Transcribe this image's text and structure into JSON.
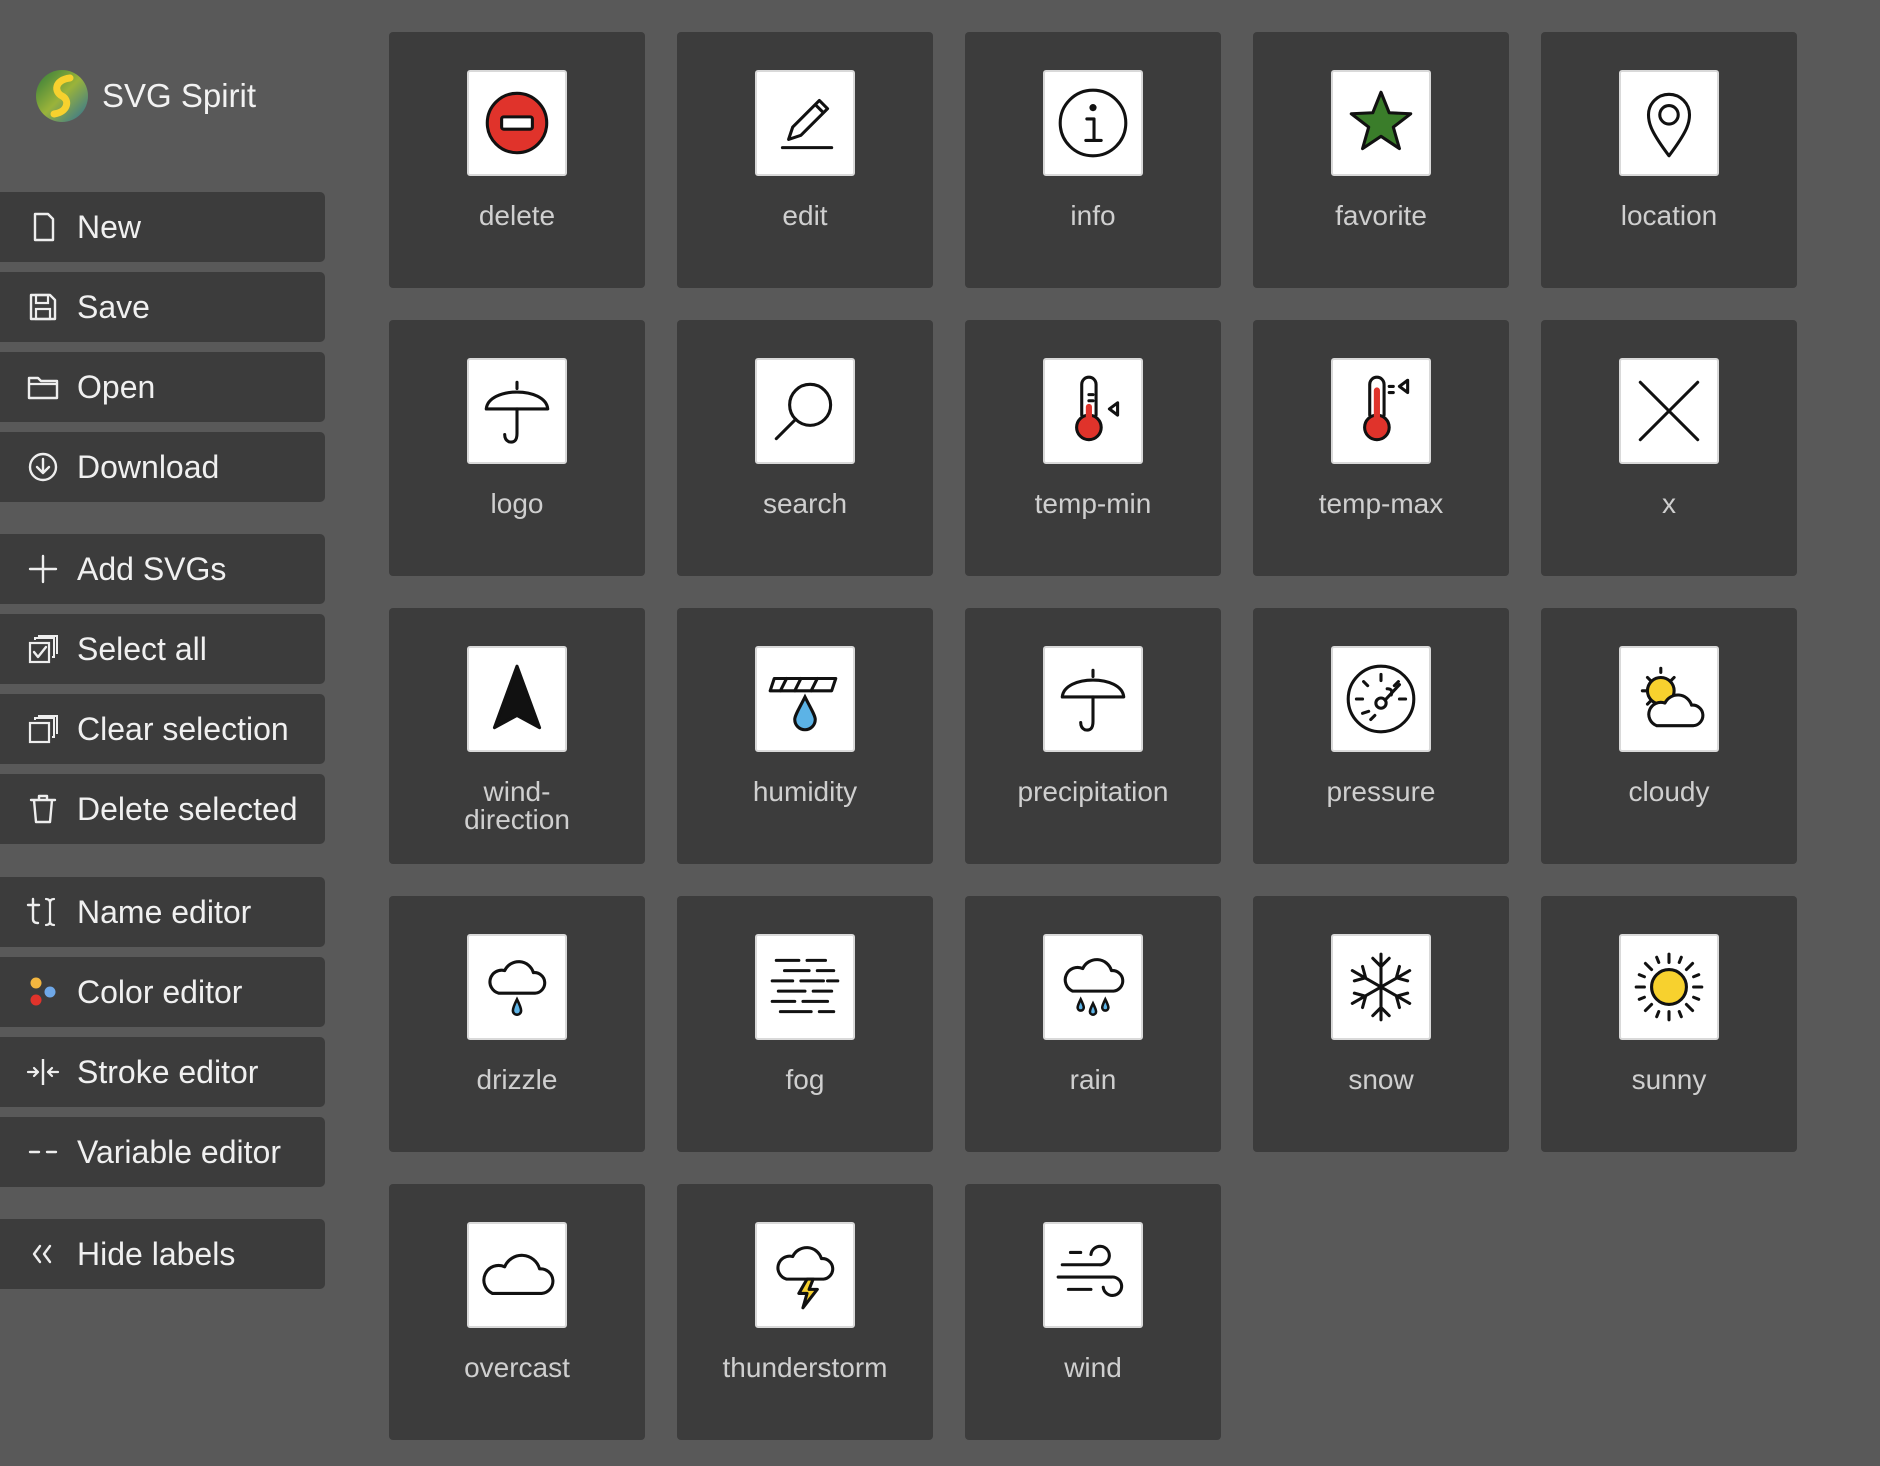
{
  "brand": {
    "name": "SVG Spirit",
    "logo_icon": "spirit-logo-icon"
  },
  "sidebar": {
    "buttons": [
      {
        "id": "new",
        "label": "New",
        "icon": "new-file-icon"
      },
      {
        "id": "save",
        "label": "Save",
        "icon": "save-icon"
      },
      {
        "id": "open",
        "label": "Open",
        "icon": "folder-icon"
      },
      {
        "id": "download",
        "label": "Download",
        "icon": "download-icon"
      },
      {
        "id": "add-svgs",
        "label": "Add SVGs",
        "icon": "plus-icon"
      },
      {
        "id": "select-all",
        "label": "Select all",
        "icon": "select-all-icon"
      },
      {
        "id": "clear-selection",
        "label": "Clear selection",
        "icon": "clear-selection-icon"
      },
      {
        "id": "delete-selected",
        "label": "Delete selected",
        "icon": "trash-icon"
      },
      {
        "id": "name-editor",
        "label": "Name editor",
        "icon": "text-cursor-icon"
      },
      {
        "id": "color-editor",
        "label": "Color editor",
        "icon": "color-dots-icon"
      },
      {
        "id": "stroke-editor",
        "label": "Stroke editor",
        "icon": "stroke-width-icon"
      },
      {
        "id": "variable-editor",
        "label": "Variable editor",
        "icon": "dashes-icon"
      },
      {
        "id": "hide-labels",
        "label": "Hide labels",
        "icon": "chevrons-left-icon"
      }
    ]
  },
  "grid": {
    "items": [
      {
        "label": "delete",
        "icon": "delete-icon"
      },
      {
        "label": "edit",
        "icon": "edit-icon"
      },
      {
        "label": "info",
        "icon": "info-icon"
      },
      {
        "label": "favorite",
        "icon": "favorite-icon"
      },
      {
        "label": "location",
        "icon": "location-icon"
      },
      {
        "label": "logo",
        "icon": "umbrella-icon"
      },
      {
        "label": "search",
        "icon": "search-icon"
      },
      {
        "label": "temp-min",
        "icon": "temp-min-icon"
      },
      {
        "label": "temp-max",
        "icon": "temp-max-icon"
      },
      {
        "label": "x",
        "icon": "x-icon"
      },
      {
        "label": "wind-\ndirection",
        "icon": "wind-direction-icon"
      },
      {
        "label": "humidity",
        "icon": "humidity-icon"
      },
      {
        "label": "precipitation",
        "icon": "precipitation-icon"
      },
      {
        "label": "pressure",
        "icon": "pressure-icon"
      },
      {
        "label": "cloudy",
        "icon": "cloudy-icon"
      },
      {
        "label": "drizzle",
        "icon": "drizzle-icon"
      },
      {
        "label": "fog",
        "icon": "fog-icon"
      },
      {
        "label": "rain",
        "icon": "rain-icon"
      },
      {
        "label": "snow",
        "icon": "snow-icon"
      },
      {
        "label": "sunny",
        "icon": "sunny-icon"
      },
      {
        "label": "overcast",
        "icon": "overcast-icon"
      },
      {
        "label": "thunderstorm",
        "icon": "thunderstorm-icon"
      },
      {
        "label": "wind",
        "icon": "wind-icon"
      }
    ]
  },
  "colors": {
    "background": "#595959",
    "panel": "#3c3c3c",
    "tile": "#ffffff",
    "label": "#cfcfcf",
    "red": "#e0332b",
    "green": "#3a7d2a",
    "yellow": "#f7d12e",
    "blue": "#5cb3e6"
  }
}
